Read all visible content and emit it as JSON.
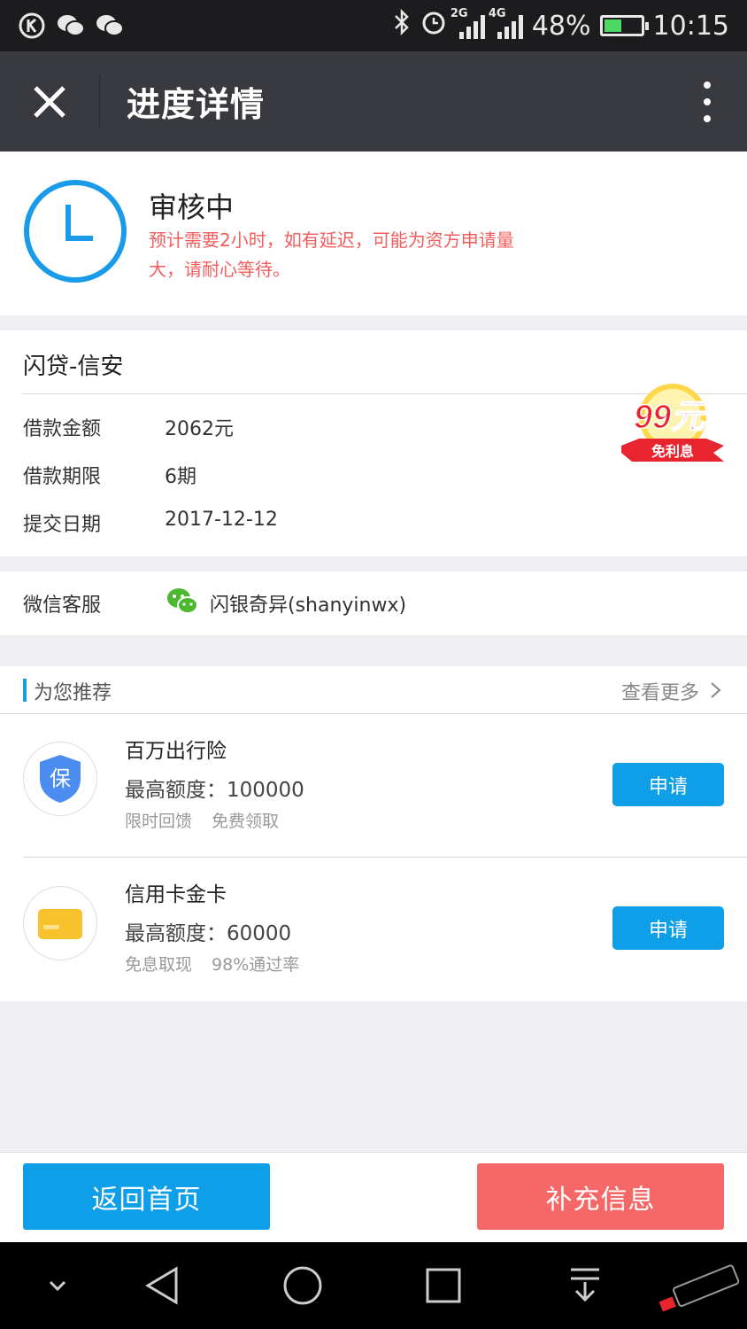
{
  "status_bar": {
    "network_2g": "2G",
    "network_4g": "4G",
    "battery": "48%",
    "time": "10:15",
    "icons": [
      "k-app-icon",
      "wechat-icon",
      "wechat-icon",
      "bluetooth-icon",
      "alarm-icon",
      "signal-icon",
      "signal-icon",
      "battery-icon"
    ]
  },
  "header": {
    "title": "进度详情"
  },
  "status": {
    "title": "审核中",
    "description": "预计需要2小时，如有延迟，可能为资方申请量大，请耐心等待。"
  },
  "loan": {
    "name": "闪贷-信安",
    "rows": [
      {
        "label": "借款金额",
        "value": "2062元"
      },
      {
        "label": "借款期限",
        "value": "6期"
      },
      {
        "label": "提交日期",
        "value": "2017-12-12"
      }
    ],
    "badge_amount": "99元",
    "badge_text": "免利息"
  },
  "wechat": {
    "label": "微信客服",
    "value": "闪银奇异(shanyinwx)"
  },
  "recommend": {
    "title": "为您推荐",
    "more": "查看更多",
    "items": [
      {
        "name": "百万出行险",
        "limit": "最高额度：100000",
        "tags": [
          "限时回馈",
          "免费领取"
        ],
        "icon_text": "保",
        "button": "申请"
      },
      {
        "name": "信用卡金卡",
        "limit": "最高额度：60000",
        "tags": [
          "免息取现",
          "98%通过率"
        ],
        "button": "申请"
      }
    ]
  },
  "actions": {
    "home": "返回首页",
    "supplement": "补充信息"
  },
  "colors": {
    "accent_blue": "#0f9ee8",
    "accent_red": "#f66868",
    "warning_text": "#f35c5c",
    "titlebar": "#393a3f"
  }
}
